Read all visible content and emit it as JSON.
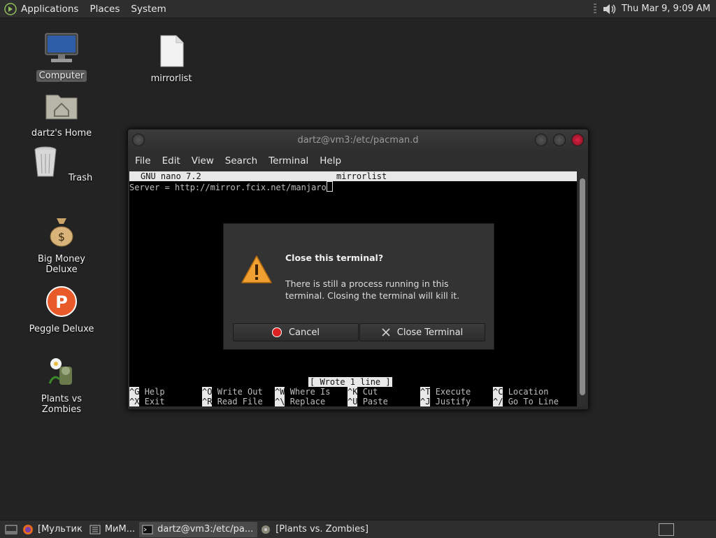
{
  "top_panel": {
    "menus": [
      "Applications",
      "Places",
      "System"
    ],
    "clock": "Thu Mar  9,  9:09 AM"
  },
  "desktop_icons": [
    {
      "label": "Computer",
      "icon": "computer-icon"
    },
    {
      "label": "mirrorlist",
      "icon": "file-icon"
    },
    {
      "label": "dartz's Home",
      "icon": "home-folder-icon"
    },
    {
      "label": "Trash",
      "icon": "trash-icon"
    },
    {
      "label": "Big Money Deluxe",
      "icon": "money-bag-icon"
    },
    {
      "label": "Peggle Deluxe",
      "icon": "peggle-icon"
    },
    {
      "label": "Plants vs Zombies",
      "icon": "plants-vs-zombies-icon"
    }
  ],
  "terminal": {
    "title": "dartz@vm3:/etc/pacman.d",
    "menu": [
      "File",
      "Edit",
      "View",
      "Search",
      "Terminal",
      "Help"
    ],
    "nano_version": "GNU nano 7.2",
    "file_name": "mirrorlist",
    "content_line": "Server = http://mirror.fcix.net/manjaro",
    "status_message": "[ Wrote 1 line ]",
    "shortcuts_row1": [
      {
        "key": "^G",
        "label": "Help"
      },
      {
        "key": "^O",
        "label": "Write Out"
      },
      {
        "key": "^W",
        "label": "Where Is"
      },
      {
        "key": "^K",
        "label": "Cut"
      },
      {
        "key": "^T",
        "label": "Execute"
      },
      {
        "key": "^C",
        "label": "Location"
      }
    ],
    "shortcuts_row2": [
      {
        "key": "^X",
        "label": "Exit"
      },
      {
        "key": "^R",
        "label": "Read File"
      },
      {
        "key": "^\\",
        "label": "Replace"
      },
      {
        "key": "^U",
        "label": "Paste"
      },
      {
        "key": "^J",
        "label": "Justify"
      },
      {
        "key": "^/",
        "label": "Go To Line"
      }
    ]
  },
  "dialog": {
    "title": "Close this terminal?",
    "message": "There is still a process running in this terminal. Closing the terminal will kill it.",
    "cancel_label": "Cancel",
    "close_label": "Close Terminal"
  },
  "taskbar": {
    "tasks": [
      {
        "label": "[Мультик",
        "icon": "firefox-icon"
      },
      {
        "label": "МиМ...",
        "icon": "app-grid-icon"
      },
      {
        "label": "dartz@vm3:/etc/pa...",
        "icon": "terminal-icon",
        "active": true
      },
      {
        "label": "[Plants vs. Zombies]",
        "icon": "plants-vs-zombies-icon"
      }
    ]
  },
  "colors": {
    "desktop_bg": "#232323",
    "panel_bg": "#2e2e2e",
    "warning_orange": "#f0a030",
    "cancel_red": "#d22"
  }
}
